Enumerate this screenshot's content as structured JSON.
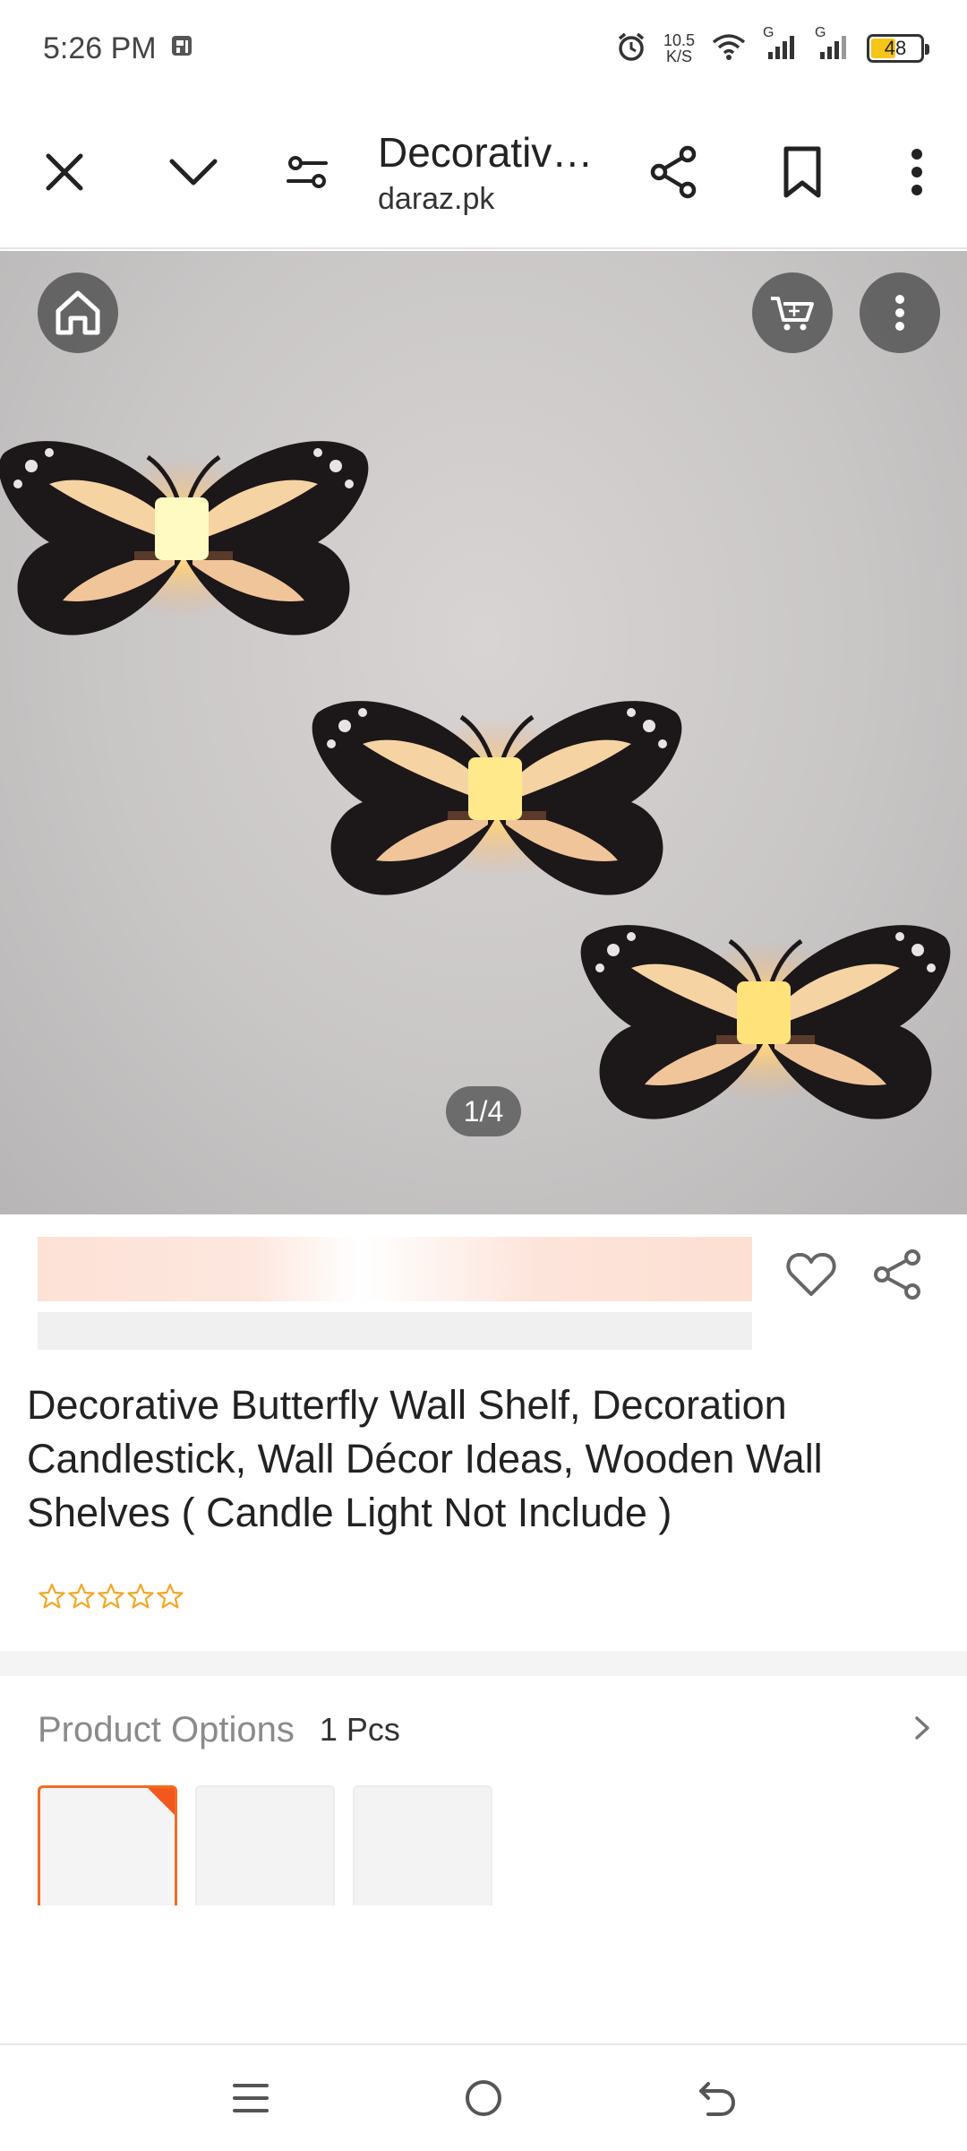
{
  "status_bar": {
    "time": "5:26 PM",
    "net_speed_value": "10.5",
    "net_speed_unit": "K/S",
    "sim1_label": "G",
    "sim2_label": "G",
    "battery": "48"
  },
  "toolbar": {
    "page_title": "Decorative Butterfly Wall Shelf",
    "site": "daraz.pk"
  },
  "gallery": {
    "counter": "1/4",
    "image_description_icon": "butterfly-candle-shelves-photo"
  },
  "product": {
    "title": "Decorative Butterfly Wall Shelf, Decoration Candlestick, Wall Décor Ideas, Wooden Wall Shelves ( Candle Light Not Include )",
    "rating_stars": 0,
    "rating_max": 5
  },
  "options": {
    "label": "Product Options",
    "value": "1 Pcs",
    "thumbnails": 3,
    "selected_index": 0
  },
  "colors": {
    "accent": "#f26b21",
    "star": "#f5a623"
  }
}
